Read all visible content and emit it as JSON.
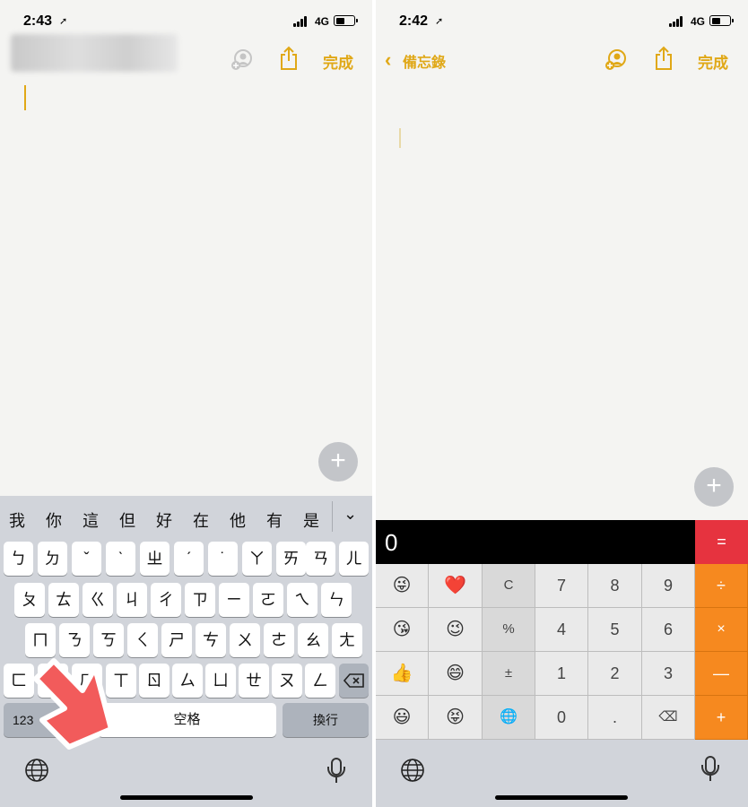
{
  "left": {
    "status": {
      "time": "2:43",
      "network": "4G"
    },
    "nav": {
      "done_label": "完成"
    },
    "candidates": [
      "我",
      "你",
      "這",
      "但",
      "好",
      "在",
      "他",
      "有",
      "是"
    ],
    "rows": [
      [
        "ㄅ",
        "ㄉ",
        "ˇ",
        "ˋ",
        "ㄓ",
        "ˊ",
        "˙",
        "ㄚ",
        "ㄞ",
        "ㄢ",
        "ㄦ"
      ],
      [
        "ㄆ",
        "ㄊ",
        "ㄍ",
        "ㄐ",
        "ㄔ",
        "ㄗ",
        "ㄧ",
        "ㄛ",
        "ㄟ",
        "ㄣ"
      ],
      [
        "ㄇ",
        "ㄋ",
        "ㄎ",
        "ㄑ",
        "ㄕ",
        "ㄘ",
        "ㄨ",
        "ㄜ",
        "ㄠ",
        "ㄤ"
      ],
      [
        "ㄈ",
        "ㄌ",
        "ㄏ",
        "ㄒ",
        "ㄖ",
        "ㄙ",
        "ㄩ",
        "ㄝ",
        "ㄡ",
        "ㄥ"
      ]
    ],
    "bottom": {
      "num_label": "123",
      "space_label": "空格",
      "return_label": "換行"
    }
  },
  "right": {
    "status": {
      "time": "2:42",
      "network": "4G"
    },
    "nav": {
      "back_label": "備忘錄",
      "done_label": "完成"
    },
    "calc": {
      "display": "0",
      "equals": "=",
      "rows": [
        [
          "😜",
          "❤️",
          "C",
          "7",
          "8",
          "9",
          "÷"
        ],
        [
          "😘",
          "😉",
          "%",
          "4",
          "5",
          "6",
          "×"
        ],
        [
          "👍",
          "😄",
          "±",
          "1",
          "2",
          "3",
          "—"
        ],
        [
          "😃",
          "😝",
          "🌐",
          "0",
          ".",
          "⌫",
          "+"
        ]
      ]
    }
  },
  "colors": {
    "accent": "#e0a817",
    "operator": "#f6891f",
    "equals": "#e6333f",
    "arrow": "#f25b5b"
  },
  "icons": [
    "share-icon",
    "add-person-icon",
    "plus-icon",
    "globe-icon",
    "microphone-icon",
    "backspace-icon",
    "chevron-down-icon",
    "location-arrow-icon"
  ]
}
